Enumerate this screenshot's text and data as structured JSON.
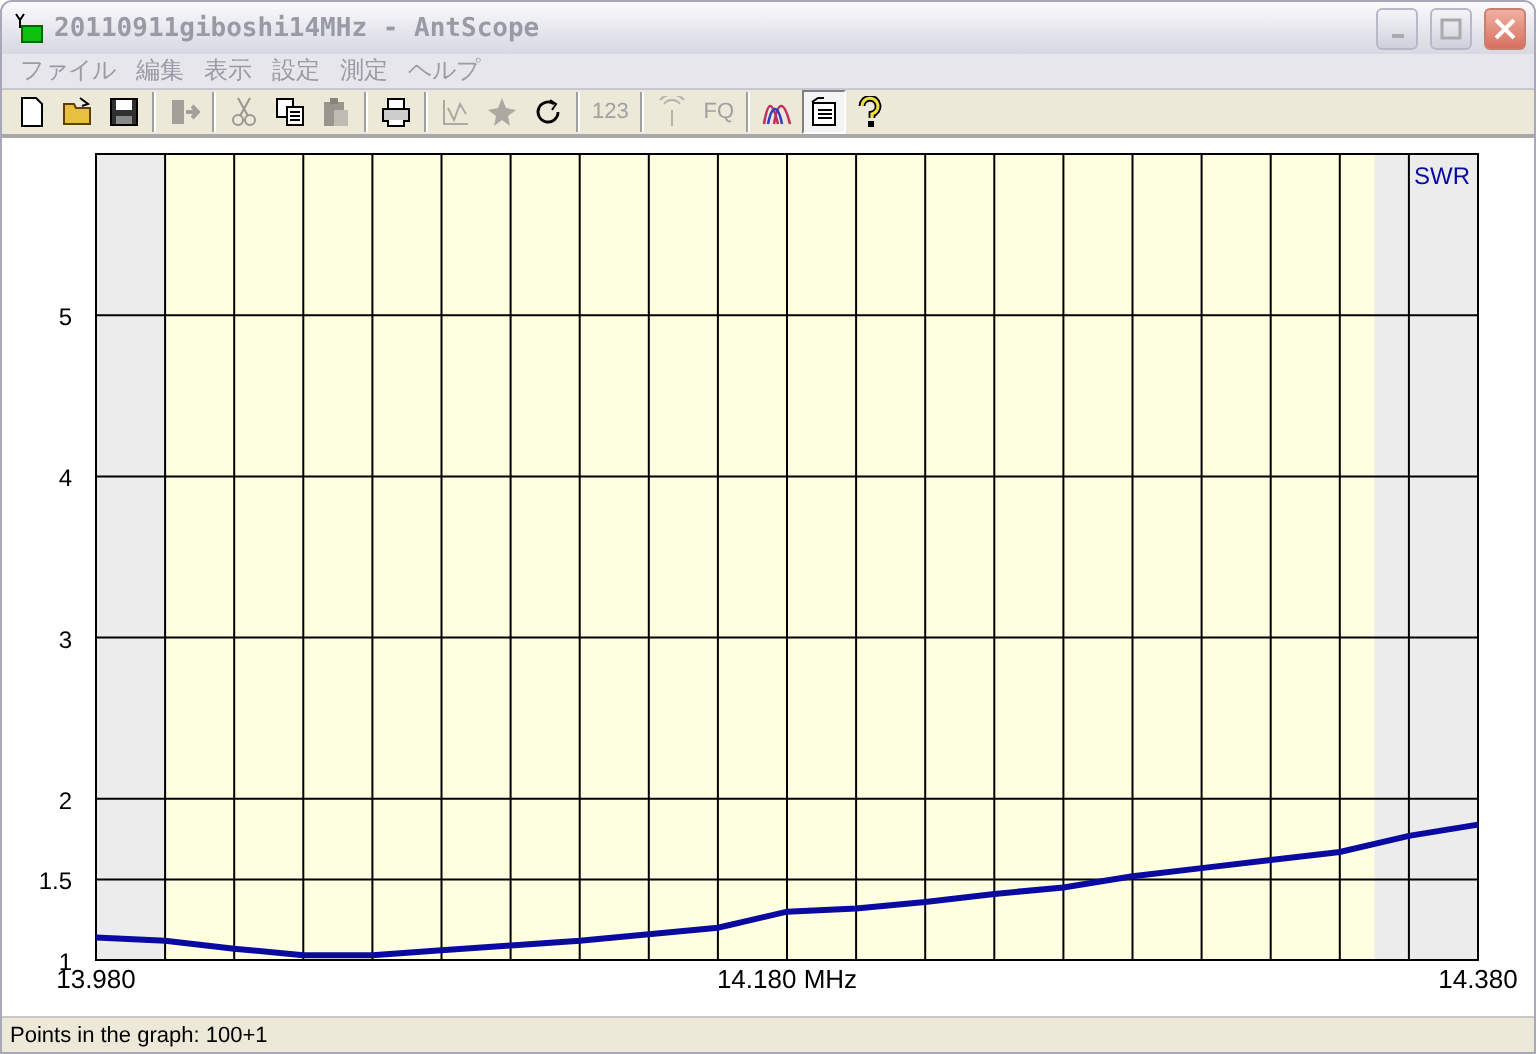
{
  "window": {
    "title": "20110911giboshi14MHz - AntScope"
  },
  "menu": [
    "ファイル",
    "編集",
    "表示",
    "設定",
    "測定",
    "ヘルプ"
  ],
  "toolbar": [
    {
      "kind": "new",
      "disabled": false,
      "selected": false
    },
    {
      "kind": "open",
      "disabled": false,
      "selected": false
    },
    {
      "kind": "save",
      "disabled": false,
      "selected": false
    },
    {
      "kind": "separator"
    },
    {
      "kind": "export",
      "disabled": true,
      "selected": false
    },
    {
      "kind": "separator"
    },
    {
      "kind": "cut",
      "disabled": true,
      "selected": false
    },
    {
      "kind": "copy",
      "disabled": false,
      "selected": false
    },
    {
      "kind": "paste",
      "disabled": true,
      "selected": false
    },
    {
      "kind": "separator"
    },
    {
      "kind": "print",
      "disabled": false,
      "selected": false
    },
    {
      "kind": "separator"
    },
    {
      "kind": "graph",
      "disabled": true,
      "selected": false
    },
    {
      "kind": "star",
      "disabled": true,
      "selected": false
    },
    {
      "kind": "refresh",
      "disabled": false,
      "selected": false
    },
    {
      "kind": "separator"
    },
    {
      "kind": "text",
      "label": "123",
      "disabled": true,
      "selected": false
    },
    {
      "kind": "separator"
    },
    {
      "kind": "antenna",
      "disabled": true,
      "selected": false
    },
    {
      "kind": "text",
      "label": "FQ",
      "disabled": true,
      "selected": false
    },
    {
      "kind": "separator"
    },
    {
      "kind": "waves",
      "disabled": false,
      "selected": false
    },
    {
      "kind": "list",
      "disabled": false,
      "selected": true
    },
    {
      "kind": "help",
      "disabled": false,
      "selected": false
    }
  ],
  "chart": {
    "chart_data": {
      "type": "line",
      "x": [
        13.98,
        14.0,
        14.02,
        14.04,
        14.06,
        14.08,
        14.1,
        14.12,
        14.14,
        14.16,
        14.18,
        14.2,
        14.22,
        14.24,
        14.26,
        14.28,
        14.3,
        14.32,
        14.34,
        14.36,
        14.38
      ],
      "series": [
        {
          "name": "SWR",
          "color": "#0a0aa0",
          "values": [
            1.14,
            1.12,
            1.07,
            1.03,
            1.03,
            1.06,
            1.09,
            1.12,
            1.16,
            1.2,
            1.3,
            1.32,
            1.36,
            1.41,
            1.45,
            1.52,
            1.57,
            1.62,
            1.67,
            1.77,
            1.84
          ]
        }
      ],
      "xlim": [
        13.98,
        14.38
      ],
      "ylim": [
        1,
        6
      ],
      "xticks": [
        {
          "value": 13.98,
          "label": "13.980"
        },
        {
          "value": 14.18,
          "label": "14.180 MHz"
        },
        {
          "value": 14.38,
          "label": "14.380"
        }
      ],
      "yticks": [
        {
          "value": 1,
          "label": "1"
        },
        {
          "value": 1.5,
          "label": "1.5"
        },
        {
          "value": 2,
          "label": "2"
        },
        {
          "value": 3,
          "label": "3"
        },
        {
          "value": 4,
          "label": "4"
        },
        {
          "value": 5,
          "label": "5"
        }
      ],
      "grid": true,
      "bands": [
        {
          "axis": "x",
          "from": 14.0,
          "to": 14.35
        }
      ]
    }
  },
  "status_bar": "Points in the graph: 100+1"
}
